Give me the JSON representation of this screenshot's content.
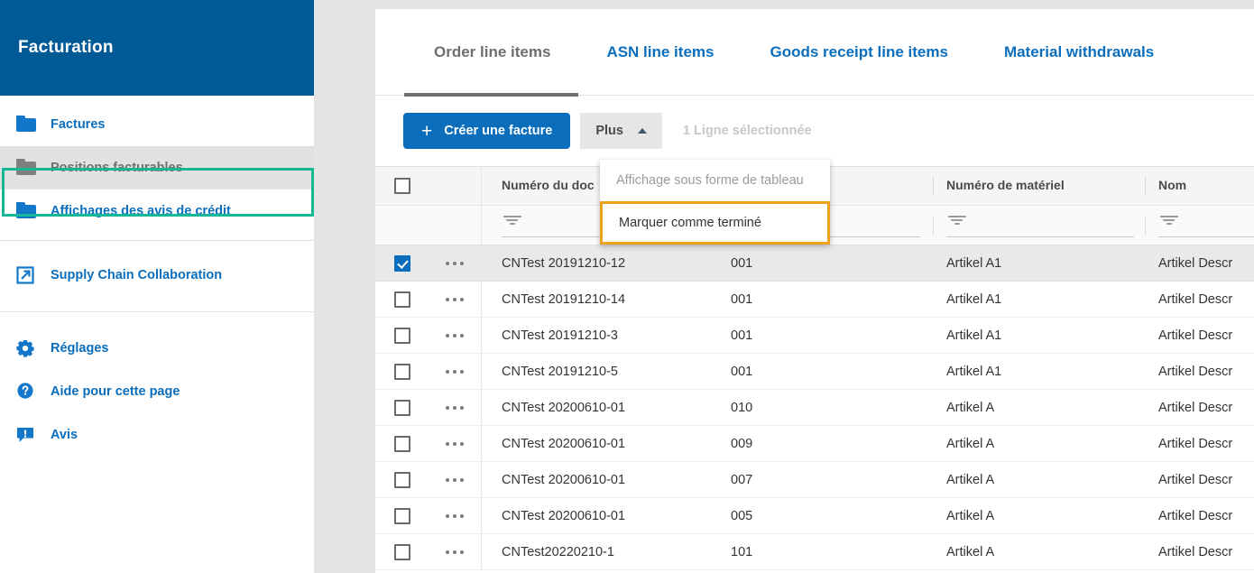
{
  "sidebar": {
    "title": "Facturation",
    "groups": [
      {
        "items": [
          {
            "label": "Factures",
            "icon": "folder-icon",
            "active": false
          },
          {
            "label": "Positions facturables",
            "icon": "folder-icon",
            "active": true
          },
          {
            "label": "Affichages des avis de crédit",
            "icon": "folder-icon",
            "active": false
          }
        ]
      },
      {
        "items": [
          {
            "label": "Supply Chain Collaboration",
            "icon": "external-link-icon",
            "active": false
          }
        ]
      },
      {
        "items": [
          {
            "label": "Réglages",
            "icon": "gear-icon",
            "active": false
          },
          {
            "label": "Aide pour cette page",
            "icon": "help-circle-icon",
            "active": false
          },
          {
            "label": "Avis",
            "icon": "notice-speech-bubble-icon",
            "active": false
          }
        ]
      }
    ]
  },
  "tabs": [
    {
      "label": "Order line items",
      "active": true
    },
    {
      "label": "ASN line items",
      "active": false
    },
    {
      "label": "Goods receipt line items",
      "active": false
    },
    {
      "label": "Material withdrawals",
      "active": false
    }
  ],
  "toolbar": {
    "create_invoice_label": "Créer une facture",
    "create_invoice_plus": "+",
    "more_label": "Plus",
    "selection_status": "1 Ligne sélectionnée"
  },
  "dropdown": {
    "items": [
      {
        "label": "Affichage sous forme de tableau",
        "state": "disabled"
      },
      {
        "label": "Marquer comme terminé",
        "state": "focused"
      }
    ]
  },
  "table": {
    "columns": [
      {
        "key": "doc",
        "label": "Numéro du doc"
      },
      {
        "key": "pos",
        "label": ""
      },
      {
        "key": "mat",
        "label": "Numéro de matériel"
      },
      {
        "key": "nom",
        "label": "Nom"
      }
    ],
    "rows": [
      {
        "selected": true,
        "doc": "CNTest 20191210-12",
        "pos": "001",
        "mat": "Artikel A1",
        "nom": "Artikel Descr"
      },
      {
        "selected": false,
        "doc": "CNTest 20191210-14",
        "pos": "001",
        "mat": "Artikel A1",
        "nom": "Artikel Descr"
      },
      {
        "selected": false,
        "doc": "CNTest 20191210-3",
        "pos": "001",
        "mat": "Artikel A1",
        "nom": "Artikel Descr"
      },
      {
        "selected": false,
        "doc": "CNTest 20191210-5",
        "pos": "001",
        "mat": "Artikel A1",
        "nom": "Artikel Descr"
      },
      {
        "selected": false,
        "doc": "CNTest 20200610-01",
        "pos": "010",
        "mat": "Artikel A",
        "nom": "Artikel Descr"
      },
      {
        "selected": false,
        "doc": "CNTest 20200610-01",
        "pos": "009",
        "mat": "Artikel A",
        "nom": "Artikel Descr"
      },
      {
        "selected": false,
        "doc": "CNTest 20200610-01",
        "pos": "007",
        "mat": "Artikel A",
        "nom": "Artikel Descr"
      },
      {
        "selected": false,
        "doc": "CNTest 20200610-01",
        "pos": "005",
        "mat": "Artikel A",
        "nom": "Artikel Descr"
      },
      {
        "selected": false,
        "doc": "CNTest20220210-1",
        "pos": "101",
        "mat": "Artikel A",
        "nom": "Artikel Descr"
      }
    ]
  },
  "colors": {
    "header_blue": "#005a96",
    "link_blue": "#0a6ebd",
    "highlight_teal": "#16b795",
    "focus_orange": "#eda219",
    "page_bg": "#e4e4e4"
  }
}
